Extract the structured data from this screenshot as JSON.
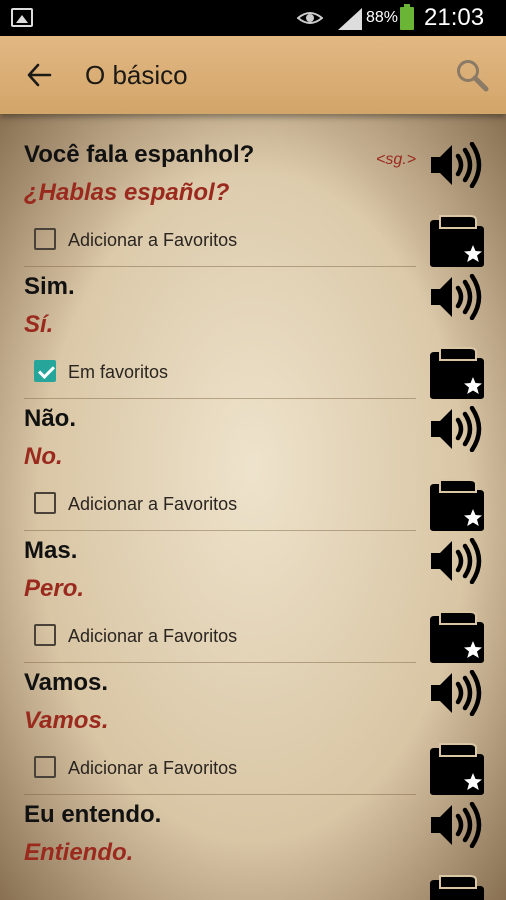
{
  "status_bar": {
    "battery": "88%",
    "time": "21:03"
  },
  "app_bar": {
    "title": "O básico"
  },
  "phrases": [
    {
      "pt": "Você fala espanhol?",
      "es": "¿Hablas español?",
      "note": "<sg.>",
      "favorite": false,
      "favorite_label": "Adicionar a Favoritos"
    },
    {
      "pt": "Sim.",
      "es": "Sí.",
      "note": "",
      "favorite": true,
      "favorite_label": "Em favoritos"
    },
    {
      "pt": "Não.",
      "es": "No.",
      "note": "",
      "favorite": false,
      "favorite_label": "Adicionar a Favoritos"
    },
    {
      "pt": "Mas.",
      "es": "Pero.",
      "note": "",
      "favorite": false,
      "favorite_label": "Adicionar a Favoritos"
    },
    {
      "pt": "Vamos.",
      "es": "Vamos.",
      "note": "",
      "favorite": false,
      "favorite_label": "Adicionar a Favoritos"
    },
    {
      "pt": "Eu entendo.",
      "es": "Entiendo.",
      "note": "",
      "favorite": false,
      "favorite_label": ""
    }
  ],
  "icons": {
    "speaker": "speaker-icon",
    "folder": "favorite-folder-icon",
    "back": "arrow-back-icon",
    "search": "search-icon"
  },
  "colors": {
    "app_bar": "#d9ae73",
    "spanish_text": "#9a2a1e",
    "checkbox_checked": "#26a69a"
  }
}
